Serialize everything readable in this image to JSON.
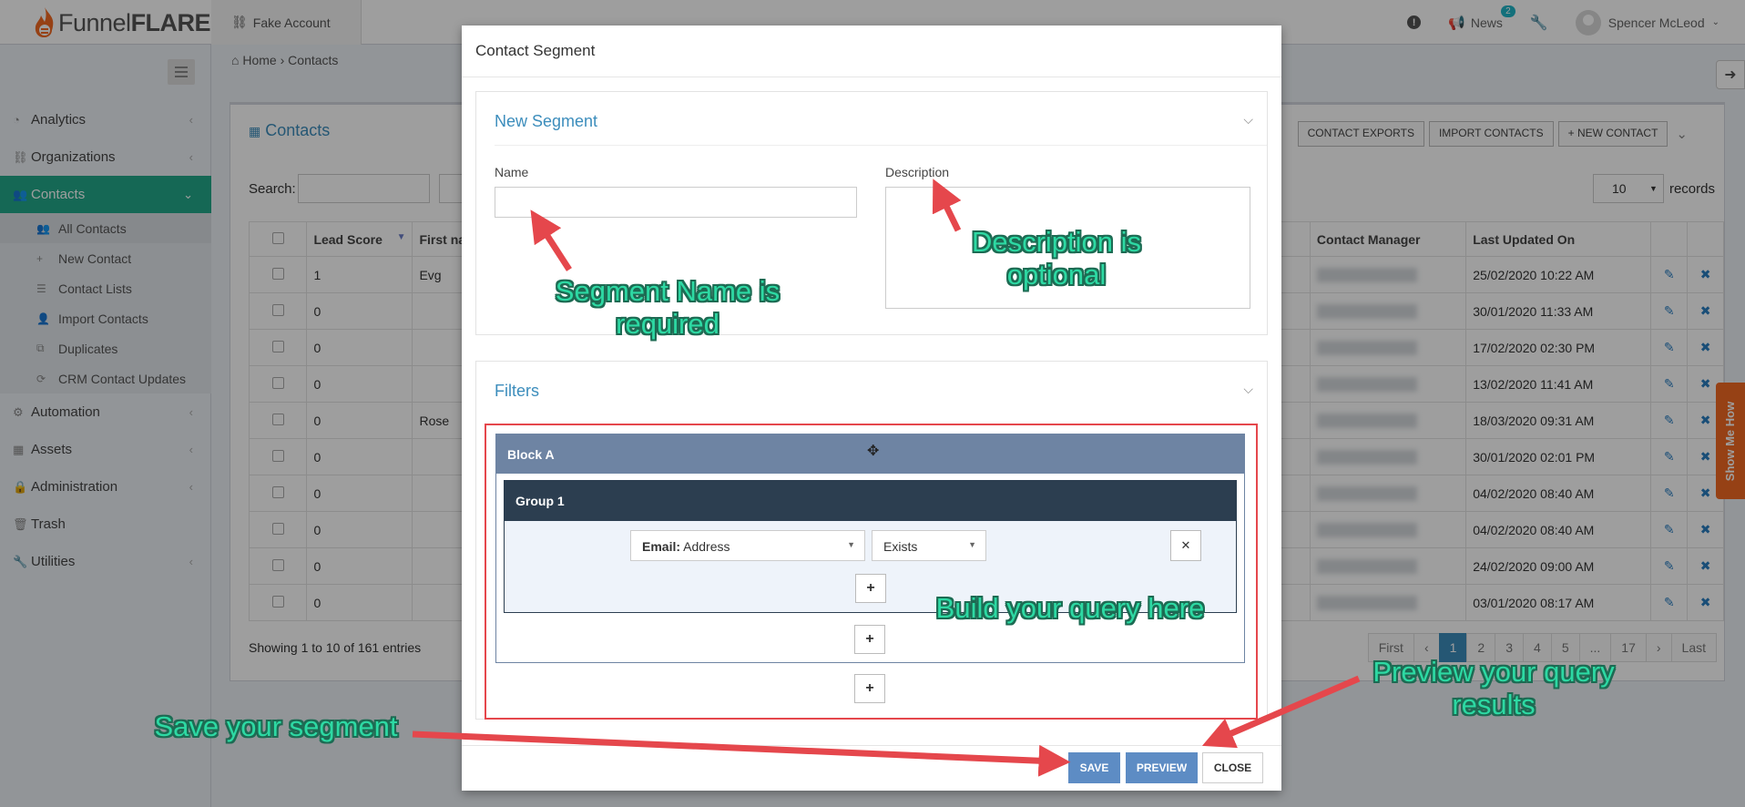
{
  "header": {
    "logo_light": "Funnel",
    "logo_bold": "FLARE",
    "account": "Fake Account",
    "news_label": "News",
    "news_count": "2",
    "user_name": "Spencer McLeod"
  },
  "sidebar": {
    "items": [
      {
        "label": "Analytics",
        "icon": "dashboard-icon"
      },
      {
        "label": "Organizations",
        "icon": "sitemap-icon"
      },
      {
        "label": "Contacts",
        "icon": "users-icon"
      },
      {
        "label": "Automation",
        "icon": "cogs-icon"
      },
      {
        "label": "Assets",
        "icon": "grid-icon"
      },
      {
        "label": "Administration",
        "icon": "lock-icon"
      },
      {
        "label": "Trash",
        "icon": "trash-icon"
      },
      {
        "label": "Utilities",
        "icon": "wrench-icon"
      }
    ],
    "contacts_sub": [
      {
        "label": "All Contacts"
      },
      {
        "label": "New Contact"
      },
      {
        "label": "Contact Lists"
      },
      {
        "label": "Import Contacts"
      },
      {
        "label": "Duplicates"
      },
      {
        "label": "CRM Contact Updates"
      }
    ]
  },
  "breadcrumb": {
    "home": "Home",
    "current": "Contacts"
  },
  "contacts_panel": {
    "title": "Contacts",
    "actions": [
      "CONTACT EXPORTS",
      "IMPORT CONTACTS",
      "NEW CONTACT"
    ],
    "search_label": "Search:",
    "records_value": "10",
    "records_label": "records",
    "columns": [
      "Lead Score",
      "First na",
      "Contact Manager",
      "Last Updated On"
    ],
    "rows": [
      {
        "score": "1",
        "first": "Evg",
        "updated": "25/02/2020 10:22 AM"
      },
      {
        "score": "0",
        "first": "",
        "updated": "30/01/2020 11:33 AM"
      },
      {
        "score": "0",
        "first": "",
        "updated": "17/02/2020 02:30 PM"
      },
      {
        "score": "0",
        "first": "",
        "updated": "13/02/2020 11:41 AM"
      },
      {
        "score": "0",
        "first": "Rose",
        "updated": "18/03/2020 09:31 AM"
      },
      {
        "score": "0",
        "first": "",
        "updated": "30/01/2020 02:01 PM"
      },
      {
        "score": "0",
        "first": "",
        "updated": "04/02/2020 08:40 AM"
      },
      {
        "score": "0",
        "first": "",
        "updated": "04/02/2020 08:40 AM"
      },
      {
        "score": "0",
        "first": "",
        "updated": "24/02/2020 09:00 AM"
      },
      {
        "score": "0",
        "first": "",
        "updated": "03/01/2020 08:17 AM"
      }
    ],
    "showing": "Showing 1 to 10 of 161 entries",
    "pager": [
      "First",
      "‹",
      "1",
      "2",
      "3",
      "4",
      "5",
      "...",
      "17",
      "›",
      "Last"
    ]
  },
  "show_me_how": "Show Me How",
  "modal": {
    "title": "Contact Segment",
    "section_segment": "New Segment",
    "name_label": "Name",
    "description_label": "Description",
    "section_filters": "Filters",
    "block_label": "Block A",
    "group_label": "Group 1",
    "field_bold": "Email:",
    "field_rest": "Address",
    "operator": "Exists",
    "save": "SAVE",
    "preview": "PREVIEW",
    "close": "CLOSE"
  },
  "annotations": {
    "name_required_1": "Segment Name is",
    "name_required_2": "required",
    "desc_optional_1": "Description is",
    "desc_optional_2": "optional",
    "build_query": "Build your query here",
    "preview_1": "Preview your query",
    "preview_2": "results",
    "save_segment": "Save your segment"
  },
  "colors": {
    "accent": "#22a98a",
    "link": "#3c8dbc",
    "annotation": "#2dd9a3",
    "arrow": "#e5474c"
  }
}
